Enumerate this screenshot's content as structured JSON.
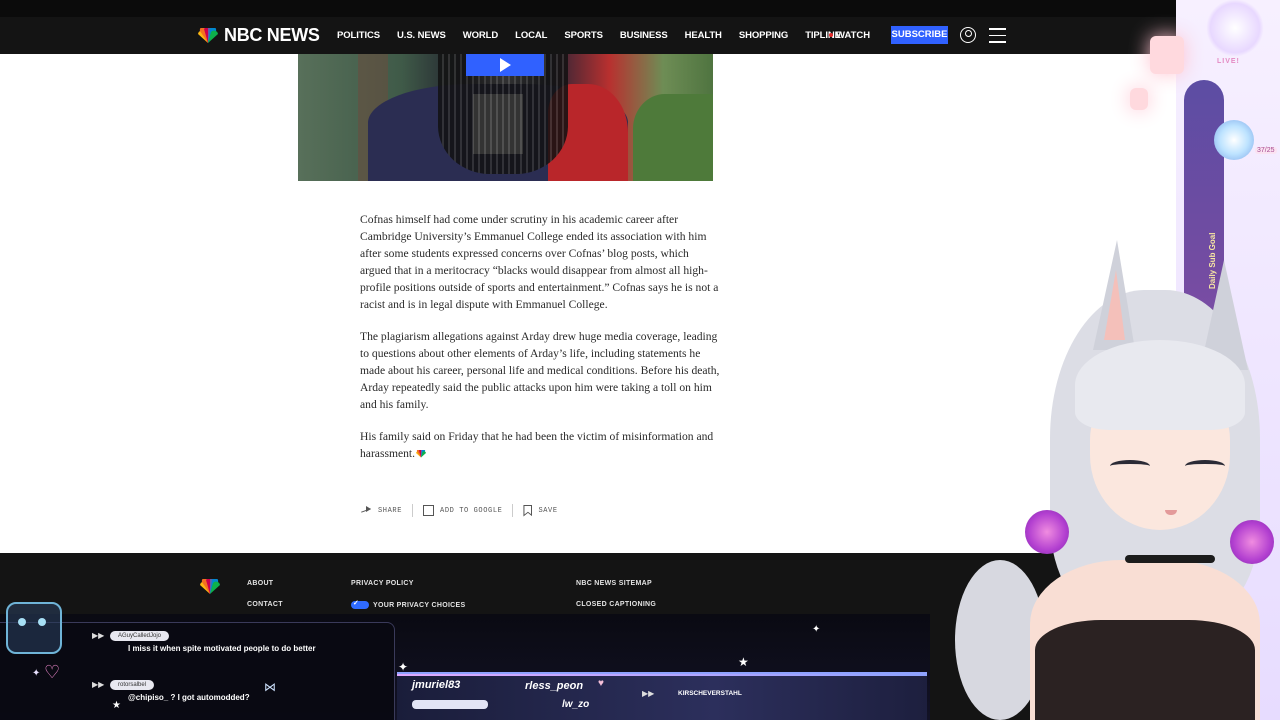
{
  "header": {
    "logo_text": "NBC NEWS",
    "nav": [
      "POLITICS",
      "U.S. NEWS",
      "WORLD",
      "LOCAL",
      "SPORTS",
      "BUSINESS",
      "HEALTH",
      "SHOPPING",
      "TIPLINE"
    ],
    "watch_label": "WATCH",
    "subscribe_label": "SUBSCRIBE"
  },
  "colors": {
    "nav_bg": "#141414",
    "accent_blue": "#3061ff",
    "live_dot": "#e62e2e"
  },
  "article": {
    "paragraphs": [
      "Cofnas himself had come under scrutiny in his academic career after Cambridge University’s Emmanuel College ended its association with him after some students expressed concerns over Cofnas’ blog posts, which argued that in a meritocracy “blacks would disappear from almost all high-profile positions outside of sports and entertainment.” Cofnas says he is not a racist and is in legal dispute with Emmanuel College.",
      "The plagiarism allegations against Arday drew huge media coverage, leading to questions about other elements of Arday’s life, including statements he made about his career, personal life and medical conditions. Before his death, Arday repeatedly said the public attacks upon him were taking a toll on him and his family.",
      "His family said on Friday that he had been the victim of misinformation and harassment."
    ]
  },
  "actions": {
    "share": "SHARE",
    "add_google": "ADD TO GOOGLE",
    "save": "SAVE"
  },
  "footer": {
    "about": "ABOUT",
    "contact": "CONTACT",
    "privacy_policy": "PRIVACY POLICY",
    "privacy_choices": "YOUR PRIVACY CHOICES",
    "sitemap": "NBC NEWS SITEMAP",
    "closed_captioning": "CLOSED CAPTIONING"
  },
  "stream": {
    "chat": [
      {
        "user": "AGuyCalledJojo",
        "message": "I miss it when spite motivated people to do better"
      },
      {
        "user": "rotorsalbel",
        "message": "@chipiso_ ? I got automodded?"
      }
    ],
    "followers": [
      "jmuriel83",
      "rless_peon",
      "lw_zo"
    ],
    "twitter_handle": "KIRSCHEVERSTAHL",
    "sub_goal": "Daily Sub Goal",
    "live": "LIVE!",
    "count": "37/25"
  }
}
